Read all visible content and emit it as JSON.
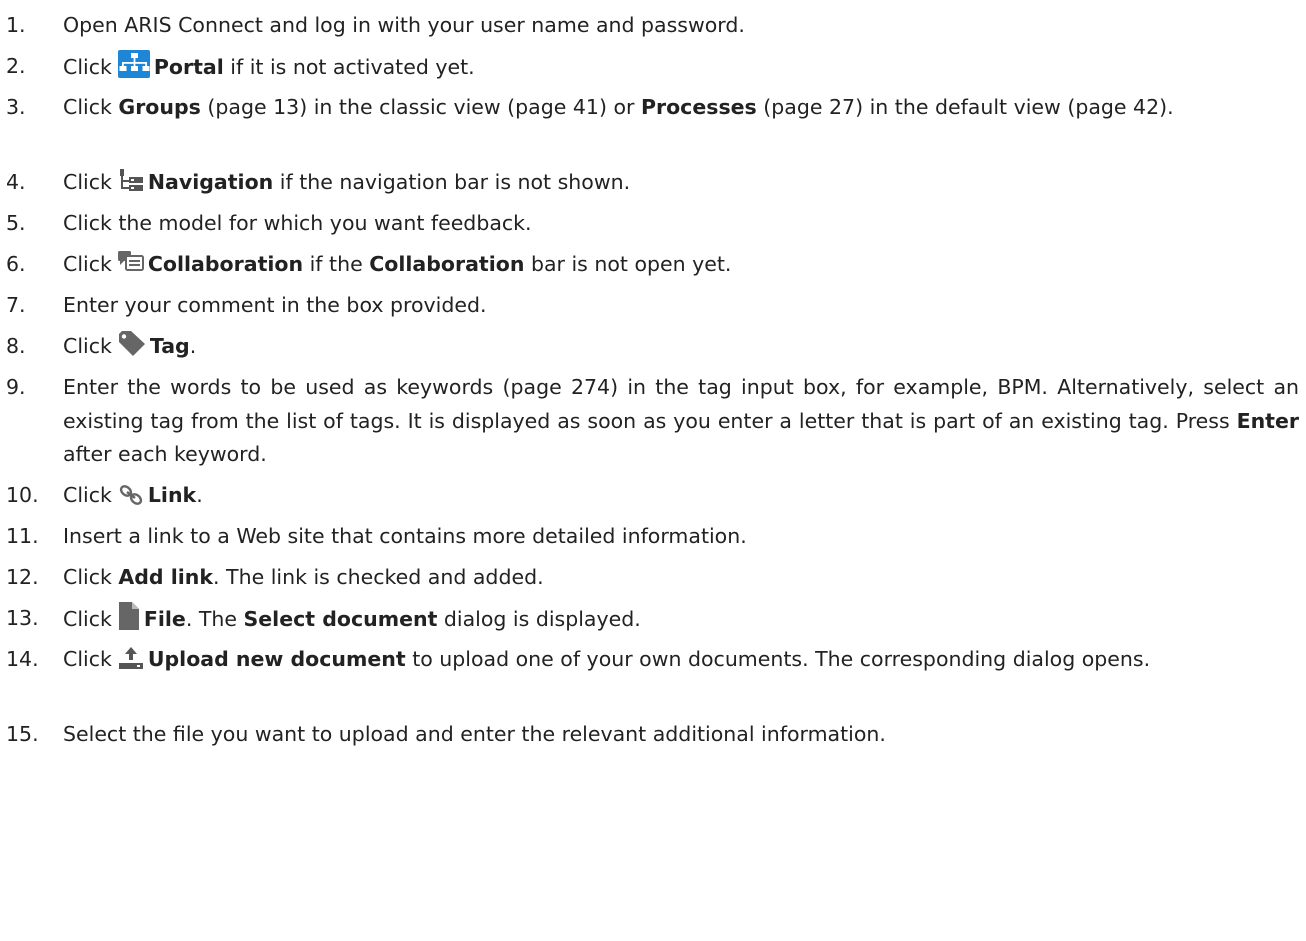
{
  "steps": [
    {
      "num": "1.",
      "a": "Open ARIS Connect and log in with your user name and password."
    },
    {
      "num": "2.",
      "a": "Click",
      "icon": "portal-icon",
      "b": "Portal",
      "c": " if it is not activated yet."
    },
    {
      "num": "3.",
      "a": "Click ",
      "b": "Groups",
      "c": " (page 13) in the classic view (page 41) or ",
      "d": "Processes",
      "e": " (page 27) in the default view (page 42)."
    },
    {
      "num": "4.",
      "a": "Click",
      "icon": "navigation-icon",
      "b": "Navigation",
      "c": " if the navigation bar is not shown."
    },
    {
      "num": "5.",
      "a": "Click the model for which you want feedback."
    },
    {
      "num": "6.",
      "a": "Click",
      "icon": "collaboration-icon",
      "b": "Collaboration",
      "c": " if the ",
      "d": "Collaboration",
      "e": " bar is not open yet."
    },
    {
      "num": "7.",
      "a": "Enter your comment in the box provided."
    },
    {
      "num": "8.",
      "a": "Click",
      "icon": "tag-icon",
      "b": "Tag",
      "c": "."
    },
    {
      "num": "9.",
      "a": "Enter the words to be used as keywords (page 274) in the tag input box, for example, BPM. Alternatively, select an existing tag from the list of tags. It is displayed as soon as you enter a letter that is part of an existing tag. Press ",
      "b": "Enter",
      "c": " after each keyword."
    },
    {
      "num": "10.",
      "a": "Click",
      "icon": "link-icon",
      "b": "Link",
      "c": "."
    },
    {
      "num": "11.",
      "a": "Insert a link to a Web site that contains more detailed information."
    },
    {
      "num": "12.",
      "a": "Click ",
      "b": "Add link",
      "c": ". The link is checked and added."
    },
    {
      "num": "13.",
      "a": "Click",
      "icon": "file-icon",
      "b": "File",
      "c": ". The ",
      "d": "Select document",
      "e": " dialog is displayed."
    },
    {
      "num": "14.",
      "a": "Click",
      "icon": "upload-icon",
      "b": "Upload new document",
      "c": " to upload one of your own documents. The corresponding dialog opens."
    },
    {
      "num": "15.",
      "a": "Select the file you want to upload and enter the relevant additional information."
    }
  ]
}
